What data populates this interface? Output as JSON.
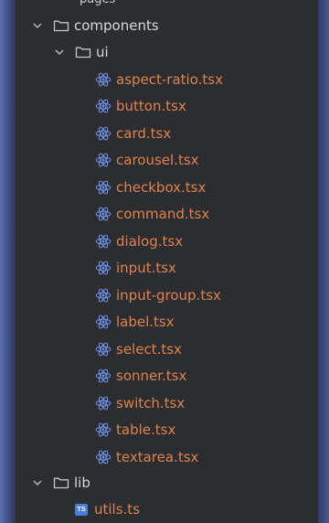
{
  "tree": {
    "partial_top_label": "pages",
    "components": {
      "label": "components",
      "icon": "folder-icon",
      "expanded": true,
      "ui": {
        "label": "ui",
        "icon": "folder-icon",
        "expanded": true,
        "files": [
          {
            "label": "aspect-ratio.tsx",
            "icon": "react-icon"
          },
          {
            "label": "button.tsx",
            "icon": "react-icon"
          },
          {
            "label": "card.tsx",
            "icon": "react-icon"
          },
          {
            "label": "carousel.tsx",
            "icon": "react-icon"
          },
          {
            "label": "checkbox.tsx",
            "icon": "react-icon"
          },
          {
            "label": "command.tsx",
            "icon": "react-icon"
          },
          {
            "label": "dialog.tsx",
            "icon": "react-icon"
          },
          {
            "label": "input.tsx",
            "icon": "react-icon"
          },
          {
            "label": "input-group.tsx",
            "icon": "react-icon"
          },
          {
            "label": "label.tsx",
            "icon": "react-icon"
          },
          {
            "label": "select.tsx",
            "icon": "react-icon"
          },
          {
            "label": "sonner.tsx",
            "icon": "react-icon"
          },
          {
            "label": "switch.tsx",
            "icon": "react-icon"
          },
          {
            "label": "table.tsx",
            "icon": "react-icon"
          },
          {
            "label": "textarea.tsx",
            "icon": "react-icon"
          }
        ]
      }
    },
    "lib": {
      "label": "lib",
      "icon": "folder-icon",
      "expanded": true,
      "files": [
        {
          "label": "utils.ts",
          "icon": "typescript-icon",
          "badge": "TS"
        }
      ]
    }
  },
  "colors": {
    "panel_bg": "#2b2d30",
    "folder_text": "#d5d8dd",
    "file_text": "#e0824e",
    "react_icon": "#6f8fe6",
    "ts_badge": "#4a7be0"
  }
}
